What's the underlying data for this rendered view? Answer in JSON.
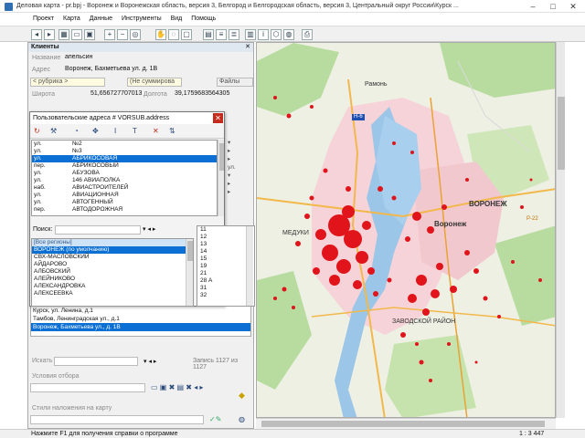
{
  "window": {
    "title": "Деловая карта - pr.bpj - Воронеж и Воронежская область, версия 3, Белгород и Белгородская область, версия 3, Центральный округ России\\Курск ..."
  },
  "menu": [
    "Проект",
    "Карта",
    "Данные",
    "Инструменты",
    "Вид",
    "Помощь"
  ],
  "clients_panel": {
    "title": "Клиенты",
    "name_label": "Название",
    "name_value": "апельсин",
    "address_label": "Адрес",
    "address_value": "Воронеж, Бахметьева ул. д. 1В",
    "rubric": "< рубрика >",
    "summ": "(Не суммирова",
    "files": "Файлы",
    "lat_label": "Широта",
    "lat_value": "51,6567277070135",
    "lon_label": "Долгота",
    "lon_value": "39,1759683564305",
    "results": [
      "Курск, ул. Ленина, д.1",
      "Тамбов, Ленинградская ул., д.1",
      "Воронеж, Бахметьева ул., д. 1В"
    ],
    "search_label": "Искать",
    "record_text": "Запись 1127 из 1127",
    "conditions_label": "Условия отбора",
    "styles_label": "Стили наложения на карту"
  },
  "dialog": {
    "title": "Пользовательские адреса # VORSUB.address",
    "streets": [
      {
        "type": "ул.",
        "name": "№2"
      },
      {
        "type": "ул.",
        "name": "№3"
      },
      {
        "type": "ул.",
        "name": "АБРИКОСОВАЯ"
      },
      {
        "type": "пер.",
        "name": "АБРИКОСОВЫЙ"
      },
      {
        "type": "ул.",
        "name": "АБУЗОВА"
      },
      {
        "type": "ул.",
        "name": "146 АВИАПОЛКА"
      },
      {
        "type": "наб.",
        "name": "АВИАСТРОИТЕЛЕЙ"
      },
      {
        "type": "ул.",
        "name": "АВИАЦИОННАЯ"
      },
      {
        "type": "ул.",
        "name": "АВТОГЕННЫЙ"
      },
      {
        "type": "пер.",
        "name": "АВТОДОРОЖНАЯ"
      }
    ],
    "search_label": "Поиск:",
    "regions": [
      "[Все регионы]",
      "ВОРОНЕЖ (по умолчанию)",
      "СВХ-МАСЛОВСКИЙ",
      "АЙДАРОВО",
      "АЛБОВСКИЙ",
      "АЛЕЙНИКОВО",
      "АЛЕКСАНДРОВКА",
      "АЛЕКСЕЕВКА"
    ],
    "numbers": [
      "11",
      "12",
      "13",
      "14",
      "15",
      "19",
      "21",
      "28 А",
      "31",
      "32"
    ]
  },
  "map": {
    "labels": {
      "city": "ВОРОНЕЖ",
      "city2": "Воронеж",
      "medyki": "МЕДУКИ",
      "region": "ЗАВОДСКОЙ РАЙОН",
      "ramon": "Рамонь",
      "road": "Р-22",
      "sign": "Н-6"
    },
    "scale": "1 : 3 447"
  },
  "status": {
    "hint": "Нажмите F1 для получения справки о программе"
  },
  "colors": {
    "accent": "#0b6fd3",
    "urban": "#e0141a",
    "water": "#9bc6e8",
    "forest": "#b8dca0"
  }
}
